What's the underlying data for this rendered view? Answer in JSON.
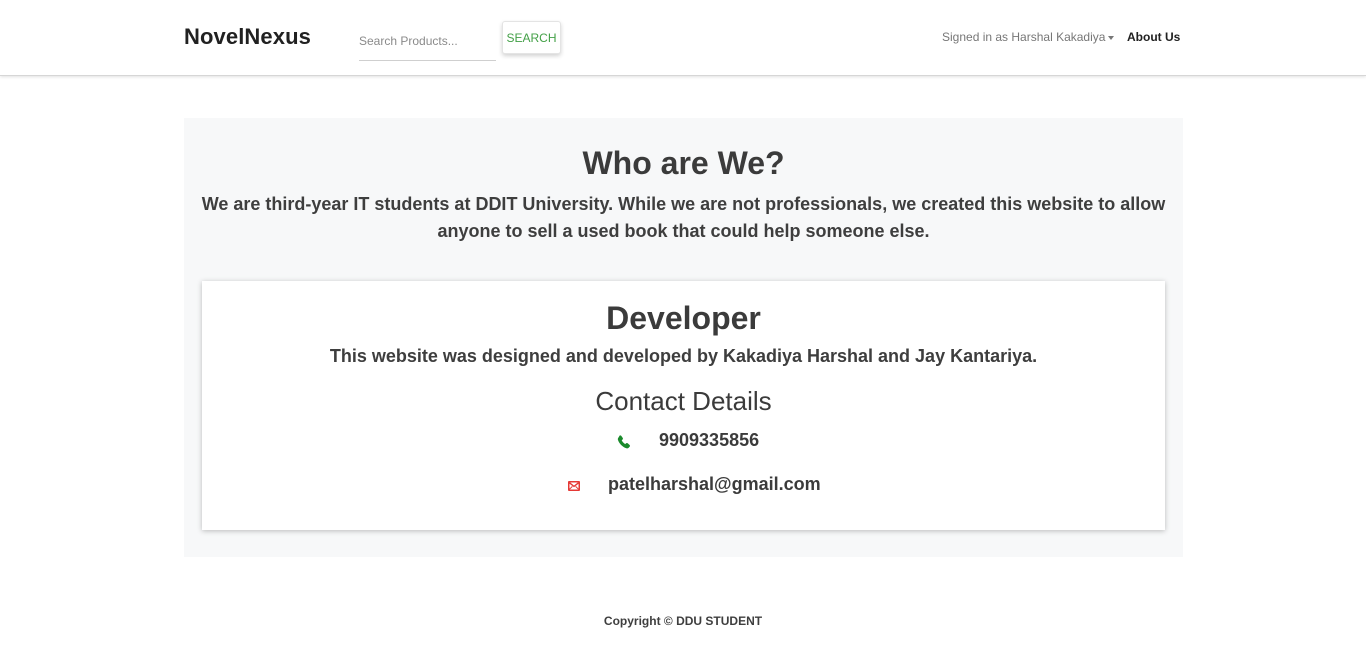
{
  "navbar": {
    "brand": "NovelNexus",
    "search": {
      "placeholder": "Search Products...",
      "value": "",
      "button_label": "SEARCH"
    },
    "user_menu_label": "Signed in as Harshal Kakadiya",
    "about_label": "About Us"
  },
  "about": {
    "title": "Who are We?",
    "intro": "We are third-year IT students at DDIT University. While we are not professionals, we created this website to allow anyone to sell a used book that could help someone else."
  },
  "developer": {
    "title": "Developer",
    "text": "This website was designed and developed by Kakadiya Harshal and Jay Kantariya.",
    "contact_title": "Contact Details",
    "contacts": [
      {
        "icon": "phone-icon",
        "value": "9909335856"
      },
      {
        "icon": "email-icon",
        "value": "patelharshal@gmail.com"
      }
    ]
  },
  "footer": {
    "copyright": "Copyright © DDU STUDENT"
  },
  "colors": {
    "accent_green": "#43a047",
    "phone_icon": "#1b8a2c",
    "email_icon": "#e53935",
    "section_bg": "#f7f8f9"
  }
}
